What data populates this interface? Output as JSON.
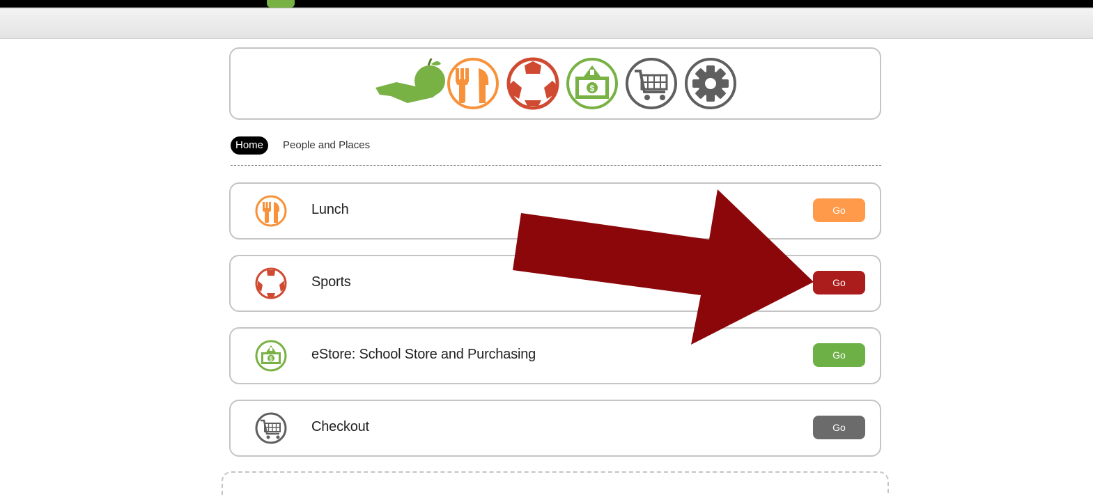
{
  "breadcrumb": {
    "home": "Home",
    "people": "People and Places"
  },
  "logo_icons": [
    "hand-apple-icon",
    "fork-knife-icon",
    "soccer-ball-icon",
    "money-icon",
    "shopping-cart-icon",
    "gear-icon"
  ],
  "rows": [
    {
      "label": "Lunch",
      "button": "Go",
      "icon": "fork-knife-icon",
      "color": "#ff9a4a"
    },
    {
      "label": "Sports",
      "button": "Go",
      "icon": "soccer-ball-icon",
      "color": "#ab1c1c"
    },
    {
      "label": "eStore: School Store and Purchasing",
      "button": "Go",
      "icon": "money-icon",
      "color": "#6cb046"
    },
    {
      "label": "Checkout",
      "button": "Go",
      "icon": "shopping-cart-icon",
      "color": "#6b6b6b"
    }
  ],
  "colors": {
    "lunch": "#f7923a",
    "sports": "#d04a32",
    "estore": "#78b144",
    "checkout": "#5f5f5f",
    "arrow": "#8b0709"
  }
}
